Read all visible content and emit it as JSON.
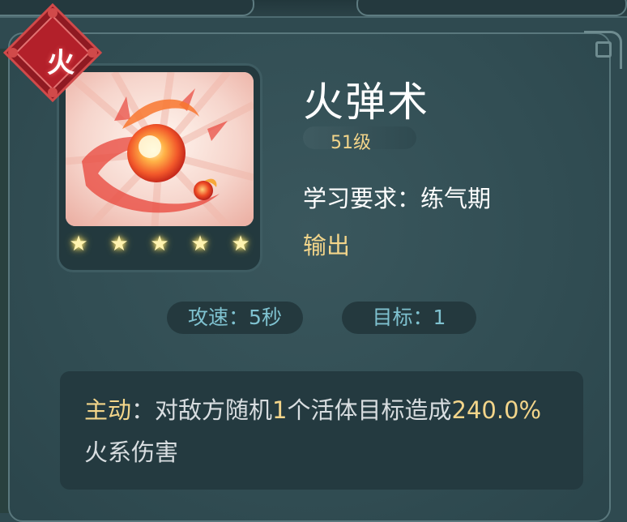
{
  "element": {
    "label": "火"
  },
  "skill": {
    "name": "火弹术",
    "level": "51级",
    "requirement": "学习要求：练气期",
    "type": "输出",
    "star_count": 5
  },
  "stats": {
    "attack_speed": "攻速：5秒",
    "target": "目标：1"
  },
  "description": {
    "prefix": "主动",
    "sep": "：",
    "text1": "对敌方随机",
    "count": "1",
    "text2": "个活体目标造成",
    "damage": "240.0%",
    "text3": "火系伤害"
  },
  "colors": {
    "background": "#2f4a50",
    "highlight": "#f3d58a",
    "stat_text": "#7fc2d0",
    "element_red": "#b3202a"
  }
}
